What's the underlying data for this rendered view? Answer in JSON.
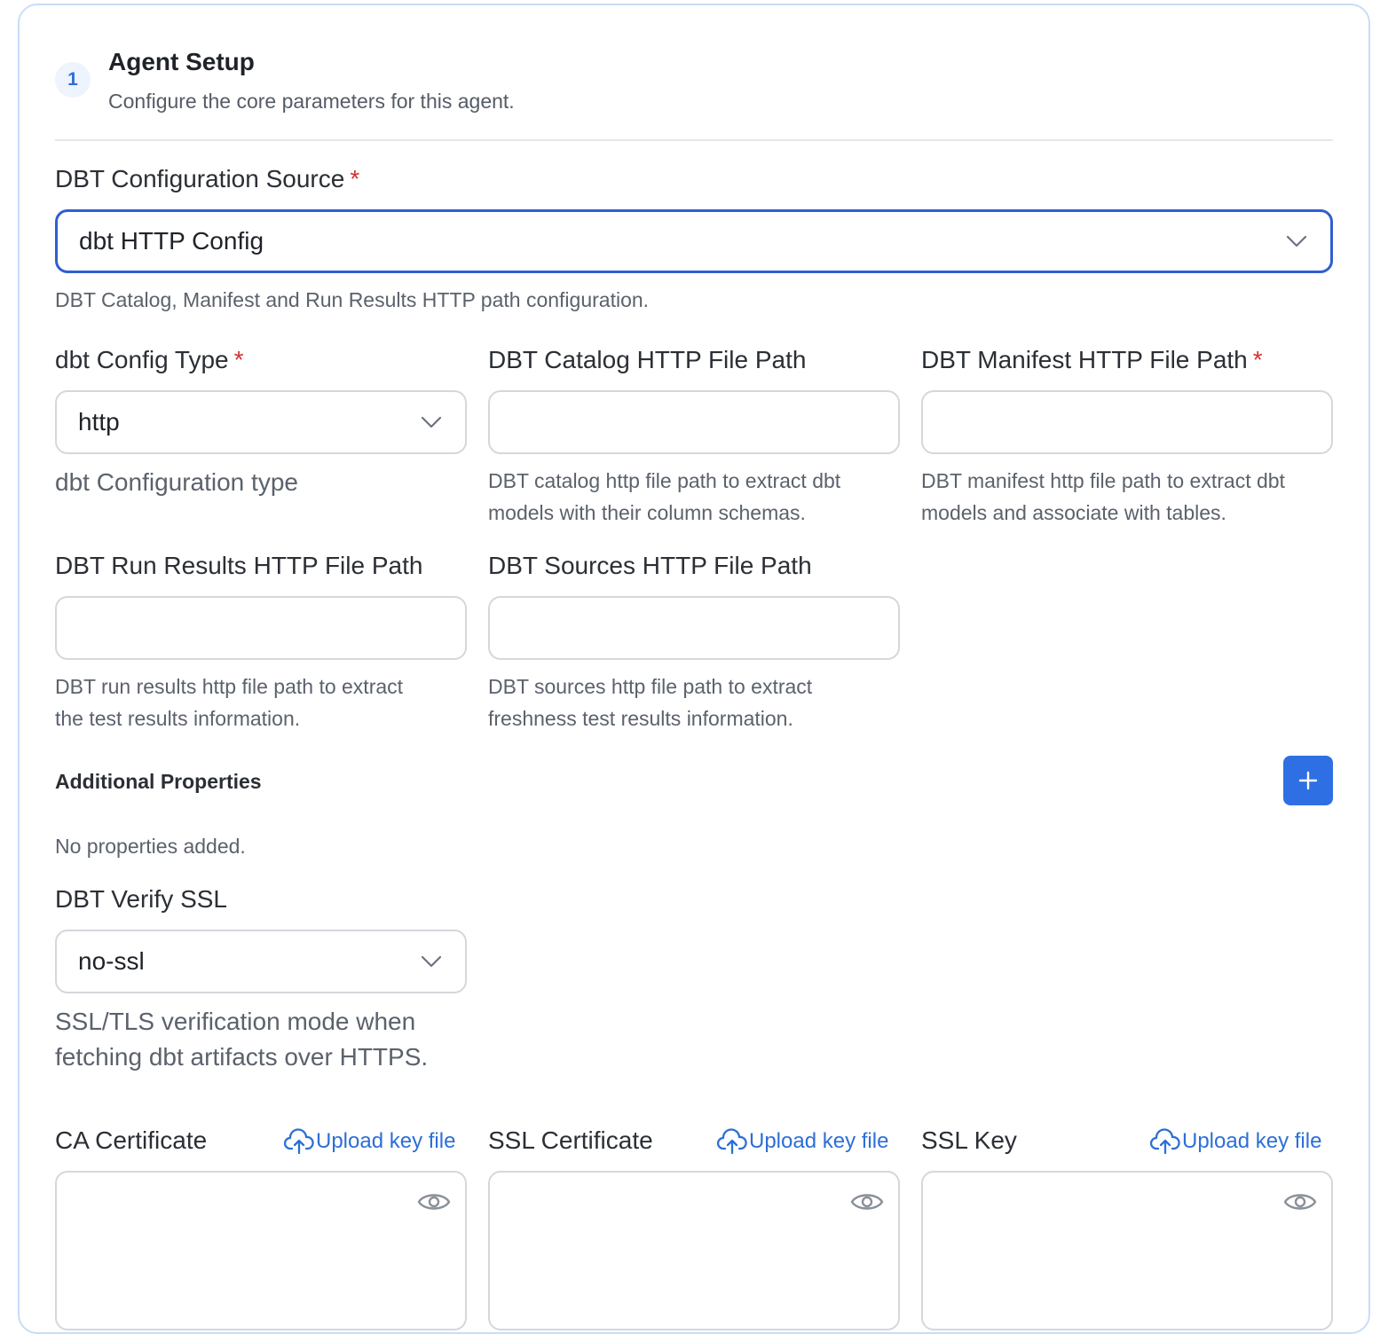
{
  "step": {
    "number": "1",
    "title": "Agent Setup",
    "subtitle": "Configure the core parameters for this agent."
  },
  "config_source": {
    "label": "DBT Configuration Source",
    "required_mark": "*",
    "value": "dbt HTTP Config",
    "help": "DBT Catalog, Manifest and Run Results HTTP path configuration."
  },
  "config_type": {
    "label": "dbt Config Type",
    "required_mark": "*",
    "value": "http",
    "help": "dbt Configuration type"
  },
  "catalog_path": {
    "label": "DBT Catalog HTTP File Path",
    "value": "",
    "help_line1": "DBT catalog http file path to extract dbt",
    "help_line2": "models with their column schemas."
  },
  "manifest_path": {
    "label": "DBT Manifest HTTP File Path",
    "required_mark": "*",
    "value": "",
    "help_line1": "DBT manifest http file path to extract dbt",
    "help_line2": "models and associate with tables."
  },
  "run_results_path": {
    "label": "DBT Run Results HTTP File Path",
    "value": "",
    "help_line1": "DBT run results http file path to extract",
    "help_line2": "the test results information."
  },
  "sources_path": {
    "label": "DBT Sources HTTP File Path",
    "value": "",
    "help_line1": "DBT sources http file path to extract",
    "help_line2": "freshness test results information."
  },
  "additional_properties": {
    "label": "Additional Properties",
    "empty_text": "No properties added.",
    "add_icon": "plus-icon"
  },
  "verify_ssl": {
    "label": "DBT Verify SSL",
    "value": "no-ssl",
    "help_line1": "SSL/TLS verification mode when",
    "help_line2": "fetching dbt artifacts over HTTPS."
  },
  "ca_certificate": {
    "label": "CA Certificate",
    "upload_label": "Upload key file"
  },
  "ssl_certificate": {
    "label": "SSL Certificate",
    "upload_label": "Upload key file"
  },
  "ssl_key": {
    "label": "SSL Key",
    "upload_label": "Upload key file"
  },
  "colors": {
    "accent": "#2f6fe4",
    "focus_border": "#2f5fd0",
    "required": "#d0322f",
    "link": "#2c6fd6"
  }
}
